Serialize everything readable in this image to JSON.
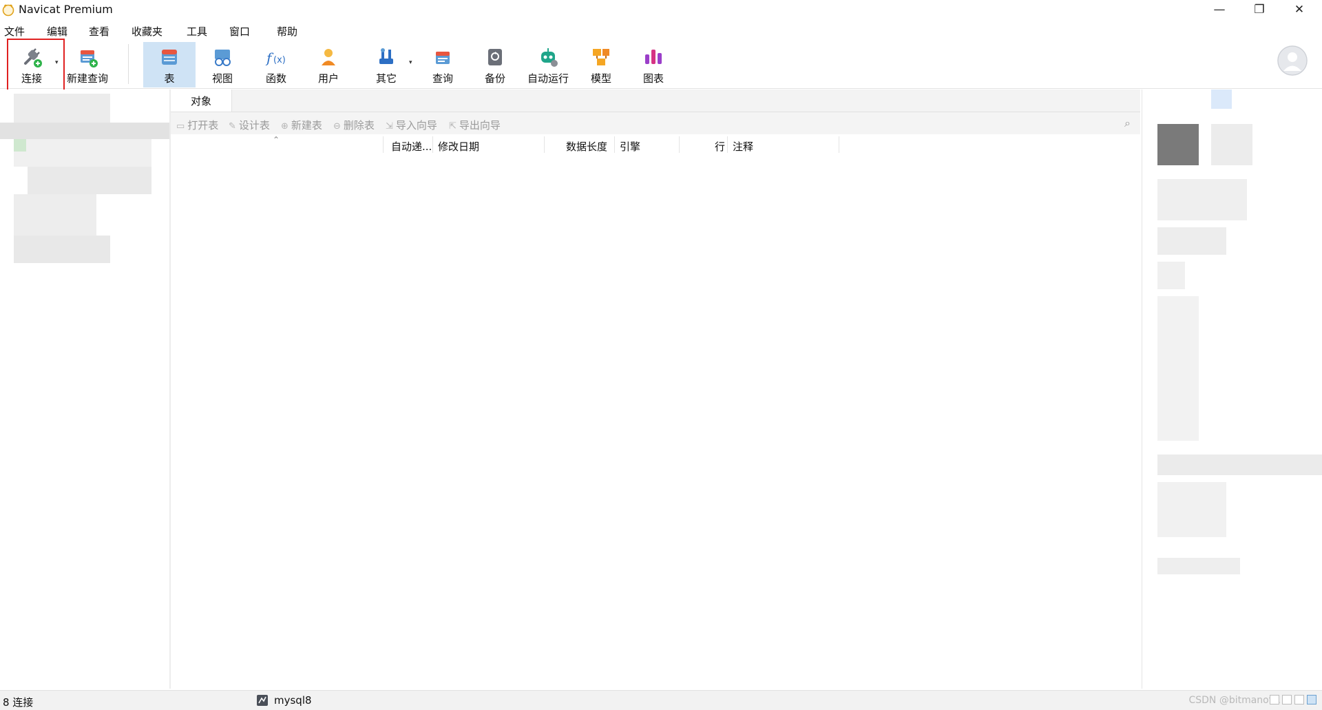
{
  "window": {
    "title": "Navicat Premium",
    "controls": [
      "—",
      "❐",
      "✕"
    ]
  },
  "menu": [
    "文件",
    "编辑",
    "查看",
    "收藏夹",
    "工具",
    "窗口",
    "帮助"
  ],
  "toolbar": {
    "connect": "连接",
    "new_query": "新建查询",
    "table": "表",
    "view": "视图",
    "function": "函数",
    "user": "用户",
    "other": "其它",
    "query": "查询",
    "backup": "备份",
    "automation": "自动运行",
    "model": "模型",
    "chart": "图表",
    "dropdown_glyph": "▾"
  },
  "tabs": {
    "objects": "对象"
  },
  "object_toolbar": {
    "open_table": "打开表",
    "design_table": "设计表",
    "new_table": "新建表",
    "delete_table": "删除表",
    "import_wizard": "导入向导",
    "export_wizard": "导出向导"
  },
  "columns": [
    "自动递...",
    "修改日期",
    "数据长度",
    "引擎",
    "行",
    "注释"
  ],
  "status": {
    "connections": "8 连接",
    "active_db": "mysql8",
    "watermark": "CSDN @bitmanof..."
  }
}
